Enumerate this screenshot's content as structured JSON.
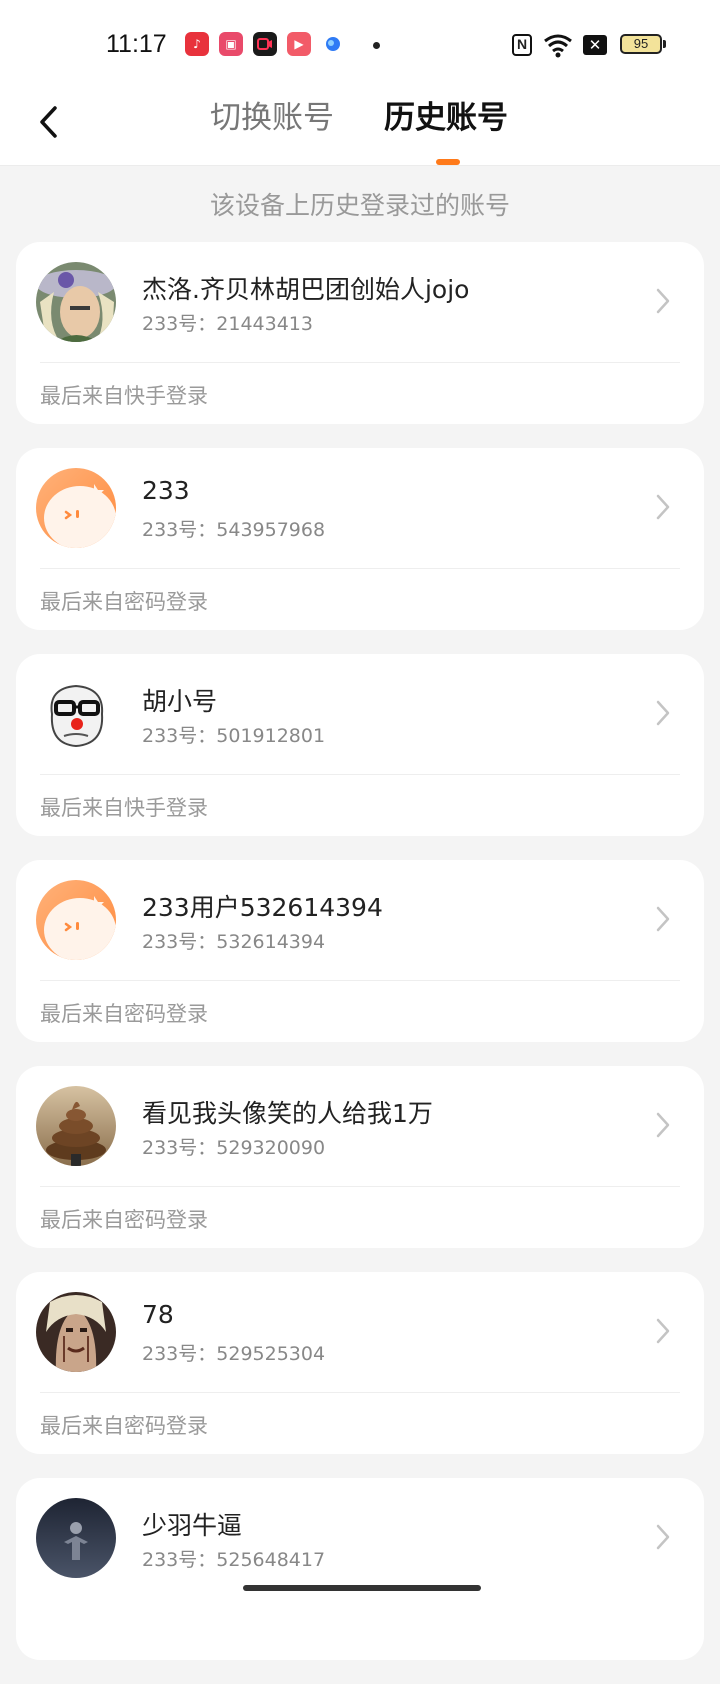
{
  "status_bar": {
    "time": "11:17",
    "battery": "95",
    "icons": [
      "music-app-icon",
      "video-app-icon",
      "camera-app-icon",
      "play-app-icon",
      "browser-app-icon",
      "nfc-icon",
      "wifi-icon",
      "sim-off-icon",
      "battery-icon"
    ]
  },
  "header": {
    "back_icon": "chevron-left-icon",
    "tabs": [
      {
        "label": "切换账号",
        "active": false
      },
      {
        "label": "历史账号",
        "active": true
      }
    ],
    "accent_color": "#ff7a1a"
  },
  "subtitle": "该设备上历史登录过的账号",
  "accounts": [
    {
      "name": "杰洛.齐贝林胡巴团创始人jojo",
      "uid": "233号：21443413",
      "source": "最后来自快手登录",
      "avatar": "anime-character-avatar"
    },
    {
      "name": "233",
      "uid": "233号：543957968",
      "source": "最后来自密码登录",
      "avatar": "default-orange-avatar"
    },
    {
      "name": "胡小号",
      "uid": "233号：501912801",
      "source": "最后来自快手登录",
      "avatar": "glasses-meme-avatar"
    },
    {
      "name": "233用户532614394",
      "uid": "233号：532614394",
      "source": "最后来自密码登录",
      "avatar": "default-orange-avatar"
    },
    {
      "name": "看见我头像笑的人给我1万",
      "uid": "233号：529320090",
      "source": "最后来自密码登录",
      "avatar": "swirl-avatar"
    },
    {
      "name": "78",
      "uid": "233号：529525304",
      "source": "最后来自密码登录",
      "avatar": "character-portrait-avatar"
    },
    {
      "name": "少羽牛逼",
      "uid": "233号：525648417",
      "source": "",
      "avatar": "dark-figure-avatar"
    }
  ]
}
